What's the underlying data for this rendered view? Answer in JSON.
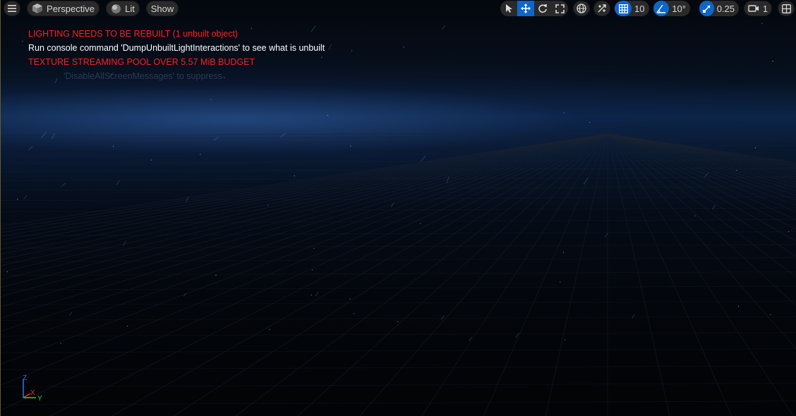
{
  "toolbar": {
    "perspective_label": "Perspective",
    "lit_label": "Lit",
    "show_label": "Show",
    "grid_snap_value": "10",
    "rotation_snap_value": "10°",
    "scale_snap_value": "0.25",
    "camera_speed_value": "1",
    "active_accent": "#0f66c8"
  },
  "messages": {
    "lighting": "LIGHTING NEEDS TO BE REBUILT (1 unbuilt object)",
    "console": "Run console command 'DumpUnbuiltLightInteractions' to see what is unbuilt",
    "texture": "TEXTURE STREAMING POOL OVER 5.57 MiB BUDGET",
    "suppress": "'DisableAllScreenMessages' to suppress",
    "warning_color": "#ff2020"
  },
  "axis": {
    "x": "X",
    "y": "Y",
    "z": "Z"
  },
  "icons": [
    "hamburger-menu-icon",
    "cube-icon",
    "lit-sphere-icon",
    "select-arrow-icon",
    "move-arrows-icon",
    "rotate-icon",
    "scale-icon",
    "globe-icon",
    "surface-snap-icon",
    "grid-icon",
    "angle-icon",
    "scale-snap-icon",
    "camera-icon",
    "layout-icon"
  ]
}
